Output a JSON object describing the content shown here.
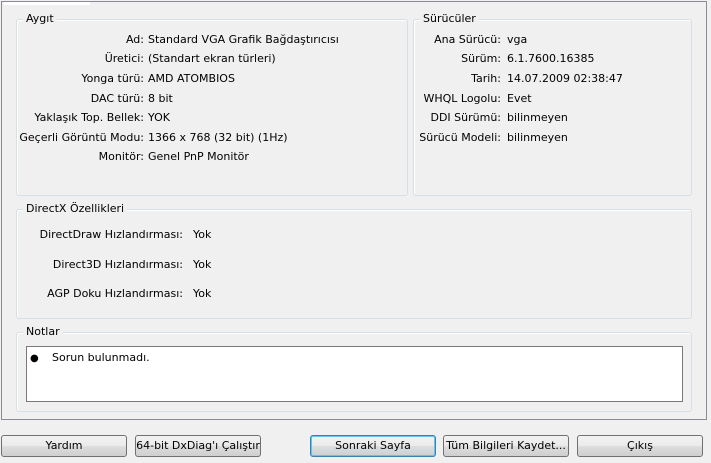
{
  "device": {
    "title": "Aygıt",
    "rows": [
      {
        "label": "Ad:",
        "value": "Standard VGA Grafik Bağdaştırıcısı"
      },
      {
        "label": "Üretici:",
        "value": "(Standart ekran türleri)"
      },
      {
        "label": "Yonga türü:",
        "value": "AMD ATOMBIOS"
      },
      {
        "label": "DAC türü:",
        "value": "8 bit"
      },
      {
        "label": "Yaklaşık Top. Bellek:",
        "value": "YOK"
      },
      {
        "label": "Geçerli Görüntü Modu:",
        "value": "1366 x 768 (32 bit) (1Hz)"
      },
      {
        "label": "Monitör:",
        "value": "Genel PnP Monitör"
      }
    ]
  },
  "drivers": {
    "title": "Sürücüler",
    "rows": [
      {
        "label": "Ana Sürücü:",
        "value": "vga"
      },
      {
        "label": "Sürüm:",
        "value": "6.1.7600.16385"
      },
      {
        "label": "Tarih:",
        "value": "14.07.2009 02:38:47"
      },
      {
        "label": "WHQL Logolu:",
        "value": "Evet"
      },
      {
        "label": "DDI Sürümü:",
        "value": "bilinmeyen"
      },
      {
        "label": "Sürücü Modeli:",
        "value": "bilinmeyen"
      }
    ]
  },
  "directx": {
    "title": "DirectX Özellikleri",
    "rows": [
      {
        "label": "DirectDraw Hızlandırması:",
        "value": "Yok"
      },
      {
        "label": "Direct3D Hızlandırması:",
        "value": "Yok"
      },
      {
        "label": "AGP Doku Hızlandırması:",
        "value": "Yok"
      }
    ]
  },
  "notes": {
    "title": "Notlar",
    "items": [
      "Sorun bulunmadı."
    ]
  },
  "buttons": {
    "help": "Yardım",
    "run64": "64-bit DxDiag'ı Çalıştır",
    "next": "Sonraki Sayfa",
    "save_all": "Tüm Bilgileri Kaydet...",
    "exit": "Çıkış"
  }
}
